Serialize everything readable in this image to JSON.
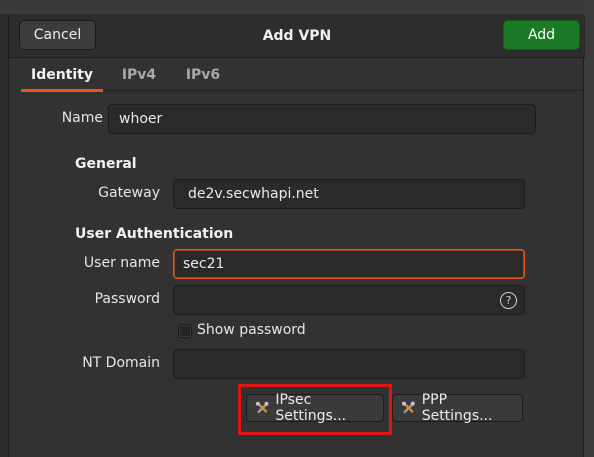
{
  "headerbar": {
    "cancel_label": "Cancel",
    "title": "Add VPN",
    "add_label": "Add"
  },
  "tabs": [
    {
      "label": "Identity",
      "active": true
    },
    {
      "label": "IPv4",
      "active": false
    },
    {
      "label": "IPv6",
      "active": false
    }
  ],
  "identity": {
    "name_label": "Name",
    "name_value": "whoer",
    "general": {
      "heading": "General",
      "gateway_label": "Gateway",
      "gateway_value": "de2v.secwhapi.net"
    },
    "user_auth": {
      "heading": "User Authentication",
      "username_label": "User name",
      "username_value": "sec21",
      "password_label": "Password",
      "password_value": "",
      "password_help_icon": "question-circle-icon",
      "show_password_label": "Show password",
      "show_password_checked": false,
      "nt_domain_label": "NT Domain",
      "nt_domain_value": ""
    },
    "buttons": {
      "ipsec_label": "IPsec Settings...",
      "ppp_label": "PPP Settings...",
      "icon": "tools-icon"
    }
  },
  "colors": {
    "accent": "#e95420",
    "add_button": "#1a7a25",
    "highlight": "#e01515"
  }
}
